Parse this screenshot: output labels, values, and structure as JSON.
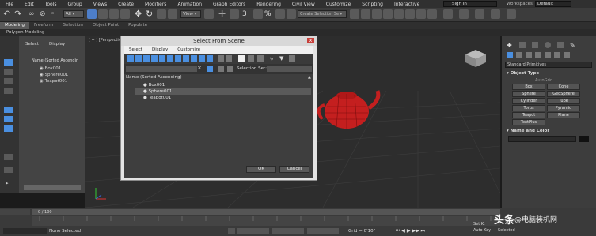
{
  "menu": [
    "File",
    "Edit",
    "Tools",
    "Group",
    "Views",
    "Create",
    "Modifiers",
    "Animation",
    "Graph Editors",
    "Rendering",
    "Civil View",
    "Customize",
    "Scripting",
    "Interactive"
  ],
  "toolbar": {
    "selection_filter": "All",
    "view_dropdown": "View",
    "snap_label": "3",
    "named_selection_placeholder": "Create Selection Se"
  },
  "account": {
    "sign_in": "Sign In"
  },
  "workspace": {
    "label": "Workspaces:",
    "value": "Default"
  },
  "ribbon_tabs": [
    {
      "label": "Modeling",
      "active": true
    },
    {
      "label": "Freeform",
      "active": false
    },
    {
      "label": "Selection",
      "active": false
    },
    {
      "label": "Object Paint",
      "active": false
    },
    {
      "label": "Populate",
      "active": false
    }
  ],
  "ribbon_sub": "Polygon Modeling",
  "scene_explorer": {
    "menu_select": "Select",
    "menu_display": "Display",
    "header": "Name (Sorted Ascendin",
    "items": [
      "Box001",
      "Sphere001",
      "Teapot001"
    ]
  },
  "viewport": {
    "label": "[ + ] [Perspective"
  },
  "dialog": {
    "title": "Select From Scene",
    "close": "x",
    "menus": [
      "Select",
      "Display",
      "Customize"
    ],
    "selection_sets_label": "Selection Set:",
    "list_header": "Name (Sorted Ascending)",
    "items": [
      "Box001",
      "Sphere001",
      "Teapot001"
    ],
    "selected_index": 1,
    "ok": "OK",
    "cancel": "Cancel"
  },
  "command_panel": {
    "dropdown": "Standard Primitives",
    "object_type_header": "Object Type",
    "autogrid": "AutoGrid",
    "buttons": [
      "Box",
      "Cone",
      "Sphere",
      "GeoSphere",
      "Cylinder",
      "Tube",
      "Torus",
      "Pyramid",
      "Teapot",
      "Plane",
      "TextPlus"
    ],
    "name_color_header": "Name and Color"
  },
  "timeline": {
    "frame": "0 / 100"
  },
  "status": {
    "selection": "None Selected",
    "grid": "Grid = 0'10\"",
    "autokey": "Auto Key",
    "selected": "Selected",
    "set_key": "Set K."
  },
  "watermark": {
    "logo_text": "头条",
    "handle": "@电脑装机网"
  },
  "colors": {
    "accent": "#3f7fd6",
    "teapot": "#c41f1f",
    "close": "#c8403a"
  }
}
